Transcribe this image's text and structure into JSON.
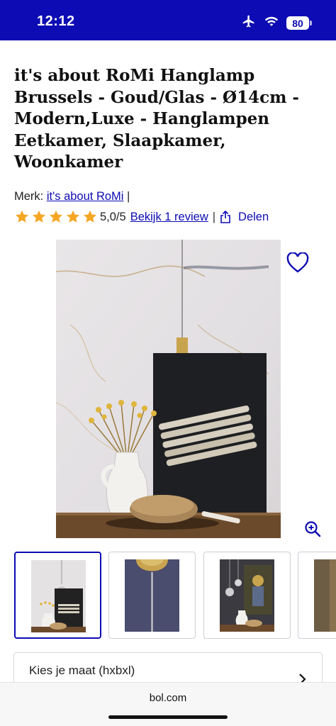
{
  "status_bar": {
    "time": "12:12",
    "battery": "80",
    "icons": [
      "airplane-icon",
      "wifi-icon",
      "battery-icon"
    ],
    "background": "#0d0bb3"
  },
  "product": {
    "title": "it's about RoMi Hanglamp Brussels - Goud/Glas - Ø14cm - Modern,Luxe - Hanglampen Eetkamer, Slaapkamer, Woonkamer",
    "brand_prefix": "Merk: ",
    "brand": "it's about RoMi",
    "brand_separator": " |",
    "rating_stars": 5,
    "rating_text": "5,0/5",
    "review_link": "Bekijk 1 review",
    "separator": "|",
    "share_label": "Delen",
    "star_color": "#f5a623",
    "accent": "#0d0bb3"
  },
  "gallery": {
    "main_image": "pendant lamp photo",
    "thumbnail_count": 4,
    "selected_thumbnail": 1
  },
  "size_selector": {
    "label": "Kies je maat (hxbxl)"
  },
  "browser": {
    "url": "bol.com"
  }
}
